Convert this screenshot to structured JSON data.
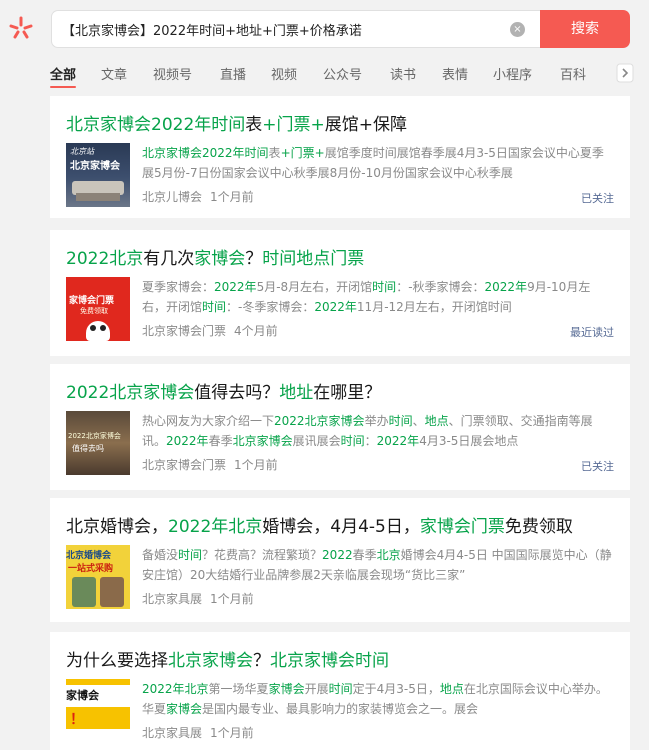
{
  "search": {
    "query": "【北京家博会】2022年时间+地址+门票+价格承诺",
    "button_label": "搜索",
    "clear_icon": "×"
  },
  "tabs": [
    "全部",
    "文章",
    "视频号",
    "直播",
    "视频",
    "公众号",
    "读书",
    "表情",
    "小程序",
    "百科"
  ],
  "results": [
    {
      "title": [
        [
          "北京家博会2022年时间",
          true
        ],
        [
          "表",
          false
        ],
        [
          "+门票+",
          true
        ],
        [
          "展馆+保障",
          false
        ]
      ],
      "snippet": [
        [
          "北京家博会2022年时间",
          true
        ],
        [
          "表",
          false
        ],
        [
          "+门票+",
          true
        ],
        [
          "展馆季度时间展馆春季展4月3-5日国家会议中心夏季展5月份-7日份国家会议中心秋季展8月份-10月份国家会议中心秋季展",
          false
        ]
      ],
      "thumb_text": [
        "北京站",
        "北京家博会"
      ],
      "source": "北京儿博会",
      "time": "1个月前",
      "status": "已关注"
    },
    {
      "title": [
        [
          "2022北京",
          true
        ],
        [
          "有几次",
          false
        ],
        [
          "家博会",
          true
        ],
        [
          "？",
          false
        ],
        [
          "时间地点门票",
          true
        ]
      ],
      "snippet": [
        [
          "夏季家博会：",
          false
        ],
        [
          "2022年",
          true
        ],
        [
          "5月-8月左右，开闭馆",
          false
        ],
        [
          "时间",
          true
        ],
        [
          "：-秋季家博会：",
          false
        ],
        [
          "2022年",
          true
        ],
        [
          "9月-10月左右，开闭馆",
          false
        ],
        [
          "时间",
          true
        ],
        [
          "：-冬季家博会：",
          false
        ],
        [
          "2022年",
          true
        ],
        [
          "11月-12月左右，开闭馆时间",
          false
        ]
      ],
      "thumb_text": [
        "家博会门票",
        "免费领取"
      ],
      "source": "北京家博会门票",
      "time": "4个月前",
      "status": "最近读过"
    },
    {
      "title": [
        [
          "2022北京家博会",
          true
        ],
        [
          "值得去吗？",
          false
        ],
        [
          "地址",
          true
        ],
        [
          "在哪里？",
          false
        ]
      ],
      "snippet": [
        [
          "热心网友为大家介绍一下",
          false
        ],
        [
          "2022北京家博会",
          true
        ],
        [
          "举办",
          false
        ],
        [
          "时间",
          true
        ],
        [
          "、",
          false
        ],
        [
          "地点",
          true
        ],
        [
          "、门票领取、交通指南等展讯。",
          false
        ],
        [
          "2022年",
          true
        ],
        [
          "春季",
          false
        ],
        [
          "北京家博会",
          true
        ],
        [
          "展讯展会",
          false
        ],
        [
          "时间",
          true
        ],
        [
          "：",
          false
        ],
        [
          "2022年",
          true
        ],
        [
          "4月3-5日展会地点",
          false
        ]
      ],
      "thumb_text": [
        "2022北京家博会",
        "值得去吗"
      ],
      "source": "北京家博会门票",
      "time": "1个月前",
      "status": "已关注"
    },
    {
      "title": [
        [
          "北京婚博会，",
          false
        ],
        [
          "2022年北京",
          true
        ],
        [
          "婚博会，4月4-5日，",
          false
        ],
        [
          "家博会门票",
          true
        ],
        [
          "免费领取",
          false
        ]
      ],
      "snippet": [
        [
          "备婚没",
          false
        ],
        [
          "时间",
          true
        ],
        [
          "？花费高？流程繁琐？",
          false
        ],
        [
          "2022",
          true
        ],
        [
          "春季",
          false
        ],
        [
          "北京",
          true
        ],
        [
          "婚博会4月4-5日 中国国际展览中心（静安庄馆）20大结婚行业品牌参展2天亲临展会现场“货比三家”",
          false
        ]
      ],
      "thumb_text": [
        "北京婚博会",
        "一站式采购"
      ],
      "source": "北京家具展",
      "time": "1个月前",
      "status": ""
    },
    {
      "title": [
        [
          "为什么要选择",
          false
        ],
        [
          "北京家博会",
          true
        ],
        [
          "？",
          false
        ],
        [
          "北京家博会时间",
          true
        ]
      ],
      "snippet": [
        [
          "2022年北京",
          true
        ],
        [
          "第一场华夏",
          false
        ],
        [
          "家博会",
          true
        ],
        [
          "开展",
          false
        ],
        [
          "时间",
          true
        ],
        [
          "定于4月3-5日，",
          false
        ],
        [
          "地点",
          true
        ],
        [
          "在北京国际会议中心举办。华夏",
          false
        ],
        [
          "家博会",
          true
        ],
        [
          "是国内最专业、最具影响力的家装博览会之一。展会",
          false
        ]
      ],
      "thumb_text": [
        "家博会",
        "！"
      ],
      "source": "北京家具展",
      "time": "1个月前",
      "status": ""
    }
  ],
  "colors": {
    "accent": "#f55a52",
    "highlight": "#07a34a",
    "link": "#576b95"
  }
}
